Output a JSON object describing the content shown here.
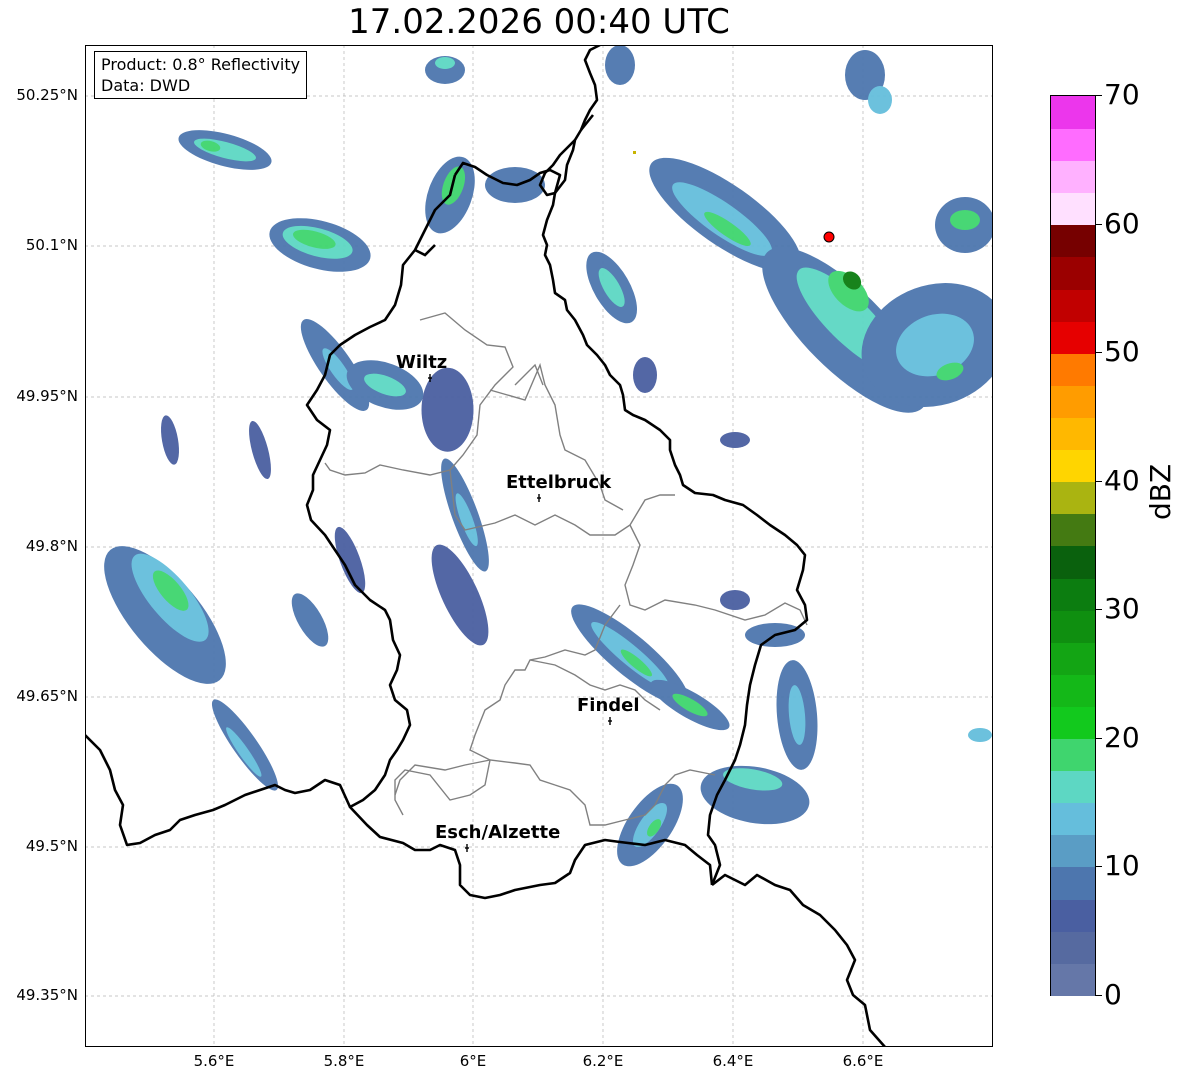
{
  "title": "17.02.2026 00:40 UTC",
  "info": {
    "product": "Product: 0.8° Reflectivity",
    "data": "Data: DWD"
  },
  "lat_ticks": [
    "50.25°N",
    "50.1°N",
    "49.95°N",
    "49.8°N",
    "49.65°N",
    "49.5°N",
    "49.35°N"
  ],
  "lon_ticks": [
    "5.6°E",
    "5.8°E",
    "6°E",
    "6.2°E",
    "6.4°E",
    "6.6°E"
  ],
  "cities": [
    {
      "name": "Wiltz"
    },
    {
      "name": "Ettelbruck"
    },
    {
      "name": "Findel"
    },
    {
      "name": "Esch/Alzette"
    }
  ],
  "colorbar": {
    "label": "dBZ",
    "ticks": [
      "0",
      "10",
      "20",
      "30",
      "40",
      "50",
      "60",
      "70"
    ],
    "colors": [
      "#6577a8",
      "#566aa0",
      "#4a5fa1",
      "#4d76ae",
      "#5a9dc5",
      "#65bedc",
      "#5dd7c3",
      "#3fd56e",
      "#12c91d",
      "#14b818",
      "#13a514",
      "#0f8f10",
      "#0c7d10",
      "#0a610d",
      "#447a12",
      "#aab411",
      "#ffd500",
      "#ffb800",
      "#ff9c00",
      "#ff7a00",
      "#e60000",
      "#c10000",
      "#9b0000",
      "#760000",
      "#ffe0ff",
      "#ffb1ff",
      "#ff6cff",
      "#ec36ec"
    ]
  },
  "colors": {
    "border": "#000000",
    "district": "#808080",
    "marker": "#ff0000"
  }
}
